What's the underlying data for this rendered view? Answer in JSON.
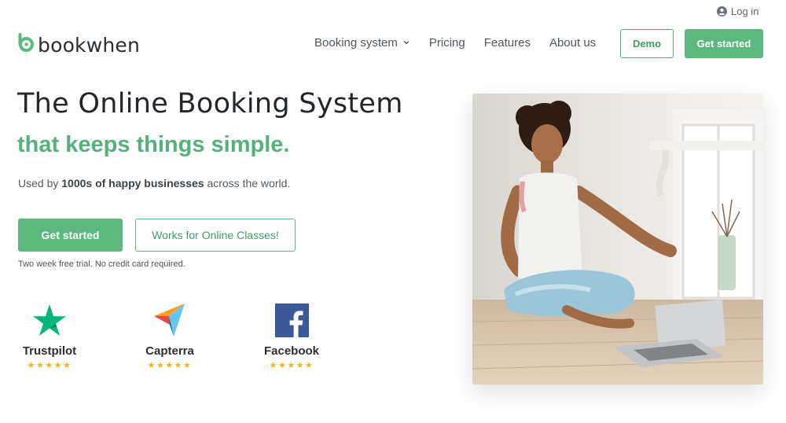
{
  "header": {
    "login_label": "Log in",
    "logo_text": "bookwhen",
    "nav": [
      {
        "label": "Booking system",
        "has_dropdown": true
      },
      {
        "label": "Pricing"
      },
      {
        "label": "Features"
      },
      {
        "label": "About us"
      }
    ],
    "demo_label": "Demo",
    "get_started_label": "Get started"
  },
  "hero": {
    "title": "The Online Booking System",
    "subtitle": "that keeps things simple.",
    "used_by_prefix": "Used by ",
    "used_by_bold": "1000s of happy businesses",
    "used_by_suffix": " across the world.",
    "cta_primary": "Get started",
    "cta_secondary": "Works for Online Classes!",
    "trial_note": "Two week free trial. No credit card required."
  },
  "reviews": [
    {
      "name": "Trustpilot",
      "icon": "trustpilot-star-icon",
      "stars": "★★★★★"
    },
    {
      "name": "Capterra",
      "icon": "capterra-icon",
      "stars": "★★★★★"
    },
    {
      "name": "Facebook",
      "icon": "facebook-icon",
      "stars": "★★★★★"
    }
  ],
  "colors": {
    "brand_green": "#5cb87e",
    "headline_green": "#56b07b",
    "star_yellow": "#f3b514",
    "facebook_blue": "#3b5998",
    "trustpilot_green": "#00b67a"
  }
}
